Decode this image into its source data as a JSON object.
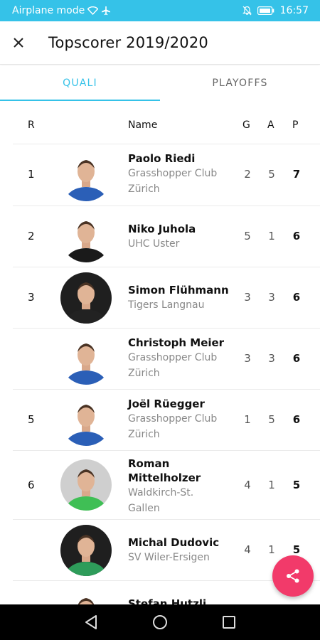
{
  "status_bar": {
    "network_label": "Airplane mode",
    "time": "16:57"
  },
  "app_bar": {
    "title": "Topscorer 2019/2020"
  },
  "tabs": [
    {
      "label": "QUALI",
      "active": true
    },
    {
      "label": "PLAYOFFS",
      "active": false
    }
  ],
  "table": {
    "headers": {
      "rank": "R",
      "name": "Name",
      "goals": "G",
      "assists": "A",
      "points": "P"
    },
    "rows": [
      {
        "rank": "1",
        "name": "Paolo Riedi",
        "club": "Grasshopper Club Zürich",
        "g": "2",
        "a": "5",
        "p": "7",
        "jersey": "#2b5fb7"
      },
      {
        "rank": "2",
        "name": "Niko Juhola",
        "club": "UHC Uster",
        "g": "5",
        "a": "1",
        "p": "6",
        "jersey": "#1a1a1a"
      },
      {
        "rank": "3",
        "name": "Simon Flühmann",
        "club": "Tigers Langnau",
        "g": "3",
        "a": "3",
        "p": "6",
        "jersey": "#222222"
      },
      {
        "rank": "",
        "name": "Christoph Meier",
        "club": "Grasshopper Club Zürich",
        "g": "3",
        "a": "3",
        "p": "6",
        "jersey": "#2b5fb7"
      },
      {
        "rank": "5",
        "name": "Joël Rüegger",
        "club": "Grasshopper Club Zürich",
        "g": "1",
        "a": "5",
        "p": "6",
        "jersey": "#2b5fb7"
      },
      {
        "rank": "6",
        "name": "Roman Mittelholzer",
        "club": "Waldkirch-St. Gallen",
        "g": "4",
        "a": "1",
        "p": "5",
        "jersey": "#3fbf55"
      },
      {
        "rank": "",
        "name": "Michal Dudovic",
        "club": "SV Wiler-Ersigen",
        "g": "4",
        "a": "1",
        "p": "5",
        "jersey": "#2e9c5a"
      },
      {
        "rank": "",
        "name": "Stefan Hutzli",
        "club": "",
        "g": "",
        "a": "",
        "p": "",
        "jersey": "#444444"
      }
    ]
  },
  "colors": {
    "accent": "#35c2e8",
    "fab": "#f23a6a"
  },
  "icons": {
    "close": "close-icon",
    "share": "share-icon",
    "back": "back-icon",
    "home": "home-icon",
    "recents": "recents-icon"
  }
}
